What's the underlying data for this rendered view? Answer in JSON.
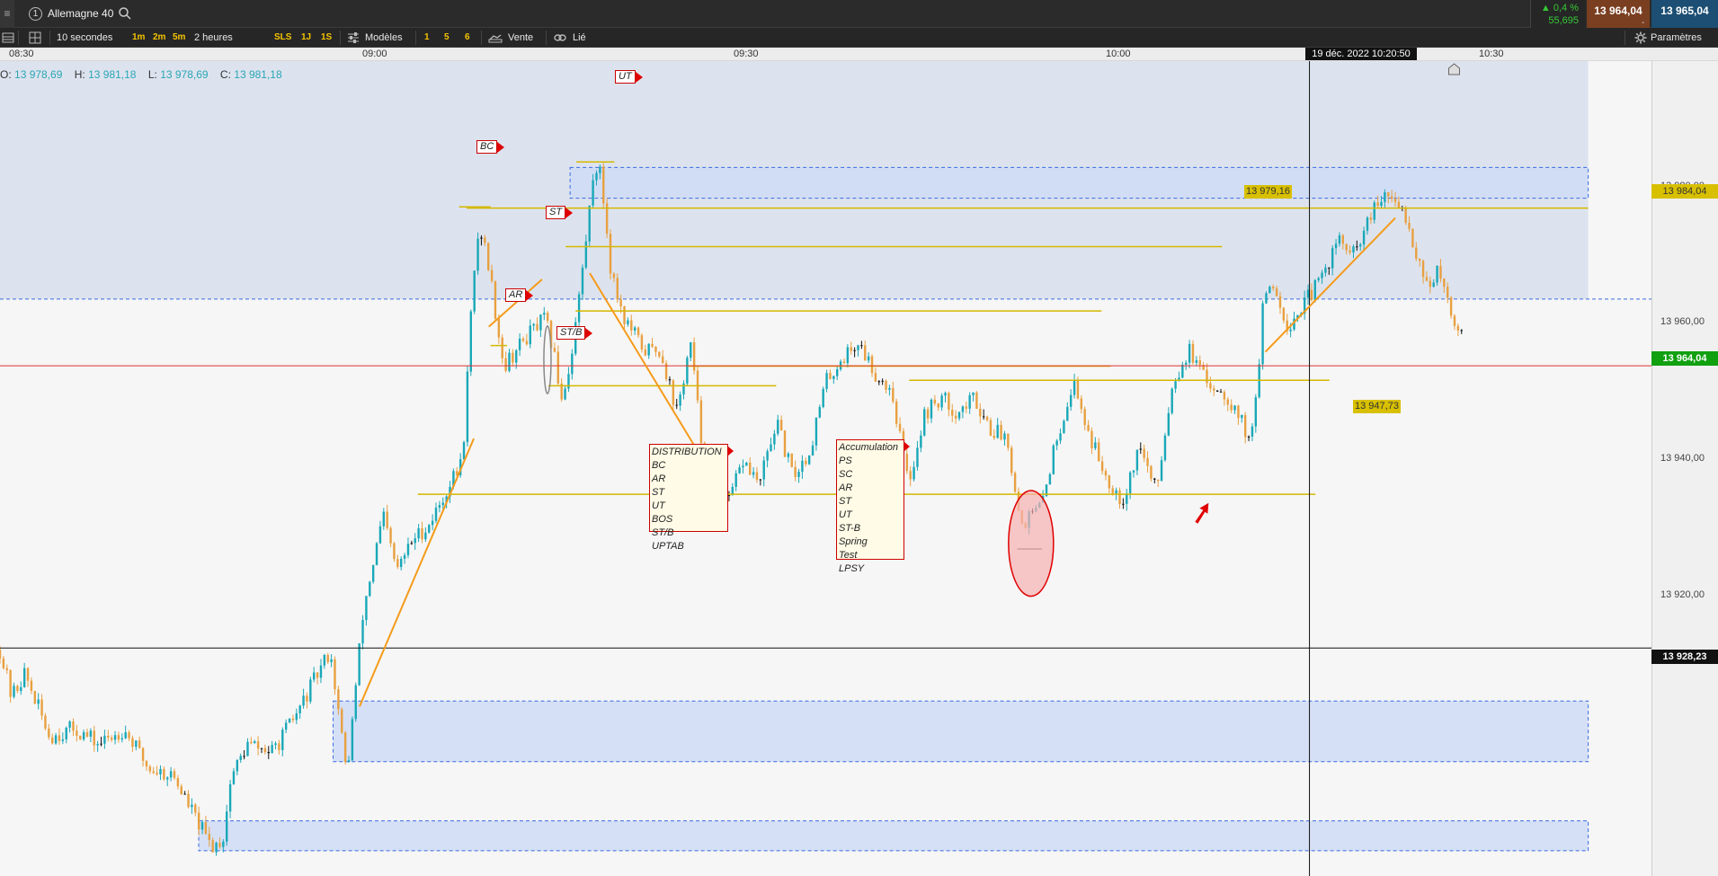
{
  "header": {
    "instrument_number": "1",
    "instrument": "Allemagne 40",
    "change_percent": "▲ 0,4 %",
    "change_points": "55,695",
    "bid": "13 964,04",
    "ask": "13 965,04",
    "ask_dash": "-"
  },
  "toolbar": {
    "interval": "10 secondes",
    "tf1": "1m",
    "tf2": "2m",
    "tf3": "5m",
    "period": "2 heures",
    "sls": "SLS",
    "j1": "1J",
    "s1": "1S",
    "models": "Modèles",
    "q1": "1",
    "q5": "5",
    "q6": "6",
    "sell": "Vente",
    "linked": "Lié",
    "settings": "Paramètres"
  },
  "time_axis": {
    "labels": [
      "08:30",
      "09:00",
      "09:30",
      "10:00",
      "10:30"
    ],
    "crosshair_time": "19 déc. 2022 10:20:50"
  },
  "ohlc": {
    "o_label": "O:",
    "o": "13 978,69",
    "h_label": "H:",
    "h": "13 981,18",
    "l_label": "L:",
    "l": "13 978,69",
    "c_label": "C:",
    "c": "13 981,18"
  },
  "price_axis": {
    "labels": [
      "13 980,00",
      "13 960,00",
      "13 940,00",
      "13 920,00"
    ],
    "tag_level": "13 984,04",
    "tag_last": "13 964,04",
    "tag_crosshair": "13 928,23"
  },
  "annotations": {
    "bc": "BC",
    "st": "ST",
    "ar": "AR",
    "stb": "ST/B",
    "ut": "UT",
    "level_high": "13 979,16",
    "level_low": "13 947,73"
  },
  "distribution_box": [
    "DISTRIBUTION",
    "BC",
    "AR",
    "ST",
    "UT",
    "BOS",
    "ST/B",
    "UPTAB"
  ],
  "accumulation_box": [
    "Accumulation",
    "PS",
    "SC",
    "AR",
    "ST",
    "UT",
    "ST-B",
    "Spring",
    "Test",
    "LPSY"
  ],
  "chart_data": {
    "type": "candlestick",
    "xlabel": "",
    "ylabel": "",
    "ylim": [
      13899.3,
      14002.7
    ],
    "x_range": [
      "08:30",
      "10:36"
    ],
    "x_ticks": [
      "08:30",
      "09:00",
      "09:30",
      "10:00",
      "10:30"
    ],
    "y_ticks": [
      13980,
      13960,
      13940,
      13920
    ],
    "crosshair": {
      "time": "19 déc. 2022 10:20:50",
      "price": 13928.23
    },
    "last_price": 13964.04,
    "horizontal_levels": [
      13984.04,
      13979.16,
      13947.73
    ],
    "colors": {
      "up": "#19a8b8",
      "down": "#e8a040",
      "doji": "#111111",
      "trend_line": "#f59b1b",
      "level_line": "#d4b800",
      "zone_fill": "#cfdcf6",
      "zone_border": "#3a6be0",
      "last_price_line": "#e03030"
    },
    "price_path": [
      [
        0,
        13928
      ],
      [
        0.007,
        13922
      ],
      [
        0.015,
        13925
      ],
      [
        0.03,
        13917
      ],
      [
        0.045,
        13918
      ],
      [
        0.06,
        13916
      ],
      [
        0.075,
        13918
      ],
      [
        0.09,
        13913
      ],
      [
        0.105,
        13912
      ],
      [
        0.12,
        13906
      ],
      [
        0.128,
        13903
      ],
      [
        0.135,
        13904
      ],
      [
        0.14,
        13912
      ],
      [
        0.15,
        13916
      ],
      [
        0.165,
        13915
      ],
      [
        0.18,
        13920
      ],
      [
        0.19,
        13924
      ],
      [
        0.2,
        13928
      ],
      [
        0.205,
        13920
      ],
      [
        0.21,
        13912
      ],
      [
        0.22,
        13933
      ],
      [
        0.232,
        13945
      ],
      [
        0.24,
        13938
      ],
      [
        0.25,
        13942
      ],
      [
        0.26,
        13944
      ],
      [
        0.27,
        13948
      ],
      [
        0.28,
        13952
      ],
      [
        0.285,
        13970
      ],
      [
        0.29,
        13982
      ],
      [
        0.295,
        13978
      ],
      [
        0.305,
        13964
      ],
      [
        0.32,
        13968
      ],
      [
        0.33,
        13970
      ],
      [
        0.335,
        13966
      ],
      [
        0.34,
        13960
      ],
      [
        0.345,
        13964
      ],
      [
        0.352,
        13975
      ],
      [
        0.356,
        13982
      ],
      [
        0.36,
        13990
      ],
      [
        0.364,
        13988
      ],
      [
        0.37,
        13976
      ],
      [
        0.378,
        13970
      ],
      [
        0.39,
        13966
      ],
      [
        0.4,
        13966
      ],
      [
        0.41,
        13958
      ],
      [
        0.418,
        13967
      ],
      [
        0.425,
        13954
      ],
      [
        0.435,
        13950
      ],
      [
        0.44,
        13946
      ],
      [
        0.45,
        13952
      ],
      [
        0.46,
        13949
      ],
      [
        0.47,
        13957
      ],
      [
        0.48,
        13950
      ],
      [
        0.49,
        13953
      ],
      [
        0.5,
        13962
      ],
      [
        0.51,
        13965
      ],
      [
        0.52,
        13967
      ],
      [
        0.53,
        13963
      ],
      [
        0.54,
        13961
      ],
      [
        0.55,
        13949
      ],
      [
        0.56,
        13958
      ],
      [
        0.57,
        13960
      ],
      [
        0.58,
        13958
      ],
      [
        0.59,
        13960
      ],
      [
        0.6,
        13956
      ],
      [
        0.61,
        13955
      ],
      [
        0.618,
        13944
      ],
      [
        0.63,
        13946
      ],
      [
        0.64,
        13955
      ],
      [
        0.65,
        13962
      ],
      [
        0.66,
        13955
      ],
      [
        0.67,
        13950
      ],
      [
        0.68,
        13947
      ],
      [
        0.69,
        13954
      ],
      [
        0.7,
        13948
      ],
      [
        0.71,
        13962
      ],
      [
        0.72,
        13966
      ],
      [
        0.73,
        13962
      ],
      [
        0.74,
        13961
      ],
      [
        0.75,
        13958
      ],
      [
        0.755,
        13955
      ],
      [
        0.76,
        13958
      ],
      [
        0.765,
        13972
      ],
      [
        0.77,
        13975
      ],
      [
        0.78,
        13969
      ],
      [
        0.79,
        13972
      ],
      [
        0.8,
        13975
      ],
      [
        0.81,
        13980
      ],
      [
        0.82,
        13978
      ],
      [
        0.83,
        13983
      ],
      [
        0.84,
        13986
      ],
      [
        0.845,
        13984
      ],
      [
        0.85,
        13984
      ],
      [
        0.855,
        13980
      ],
      [
        0.86,
        13977
      ],
      [
        0.865,
        13974
      ],
      [
        0.87,
        13976
      ],
      [
        0.88,
        13970
      ],
      [
        0.885,
        13968
      ]
    ]
  }
}
